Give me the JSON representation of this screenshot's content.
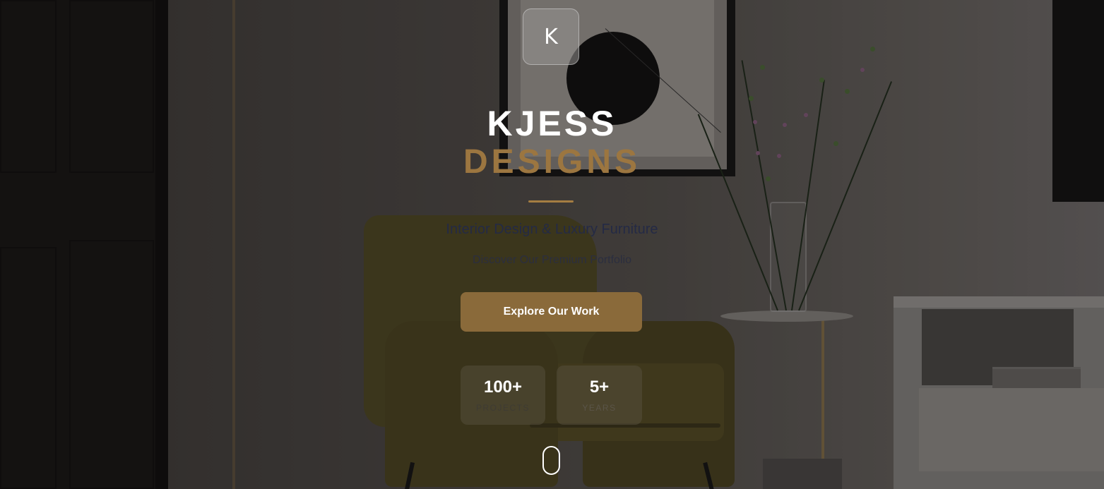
{
  "logo": {
    "letter": "K",
    "icon": "k-monogram-icon"
  },
  "brand": {
    "line1": "KJESS",
    "line2": "DESIGNS"
  },
  "hero": {
    "tagline": "Interior Design & Luxury Furniture",
    "subtitle": "Discover Our Premium Portfolio",
    "cta_label": "Explore Our Work"
  },
  "stats": [
    {
      "value": "100+",
      "label": "PROJECTS"
    },
    {
      "value": "5+",
      "label": "YEARS"
    }
  ],
  "scroll": {
    "icon": "mouse-scroll-icon"
  },
  "colors": {
    "accent": "#9c7640",
    "button": "#8a6a3a",
    "title": "#ffffff",
    "tagline": "#242a45"
  }
}
